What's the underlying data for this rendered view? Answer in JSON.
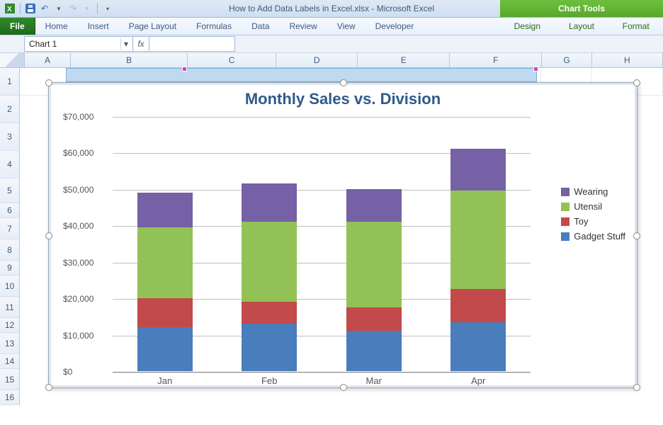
{
  "titlebar": {
    "doc_title": "How to Add Data Labels in Excel.xlsx - Microsoft Excel",
    "chart_tools_label": "Chart Tools"
  },
  "ribbon": {
    "file": "File",
    "tabs": [
      "Home",
      "Insert",
      "Page Layout",
      "Formulas",
      "Data",
      "Review",
      "View",
      "Developer"
    ],
    "ctx_tabs": [
      "Design",
      "Layout",
      "Format"
    ]
  },
  "fxbar": {
    "namebox_value": "Chart 1",
    "fx_symbol": "fx"
  },
  "columns": [
    "A",
    "B",
    "C",
    "D",
    "E",
    "F",
    "G",
    "H"
  ],
  "rows": [
    "1",
    "2",
    "3",
    "4",
    "5",
    "6",
    "7",
    "8",
    "9",
    "10",
    "11",
    "12",
    "13",
    "14",
    "15",
    "16"
  ],
  "chart_title": "Monthly Sales vs. Division",
  "legend": {
    "wearing": "Wearing",
    "utensil": "Utensil",
    "toy": "Toy",
    "gadget": "Gadget Stuff"
  },
  "y_ticks": [
    "$70,000",
    "$60,000",
    "$50,000",
    "$40,000",
    "$30,000",
    "$20,000",
    "$10,000",
    "$0"
  ],
  "x_ticks": [
    "Jan",
    "Feb",
    "Mar",
    "Apr"
  ],
  "chart_data": {
    "type": "bar",
    "stacked": true,
    "title": "Monthly Sales vs. Division",
    "xlabel": "",
    "ylabel": "",
    "ylim": [
      0,
      70000
    ],
    "y_format": "$#,##0",
    "categories": [
      "Jan",
      "Feb",
      "Mar",
      "Apr"
    ],
    "series": [
      {
        "name": "Gadget Stuff",
        "color": "#4a7dbb",
        "values": [
          12000,
          13000,
          11000,
          13500
        ]
      },
      {
        "name": "Toy",
        "color": "#c24a4a",
        "values": [
          8000,
          6000,
          6500,
          9000
        ]
      },
      {
        "name": "Utensil",
        "color": "#92c255",
        "values": [
          19500,
          22000,
          23500,
          27000
        ]
      },
      {
        "name": "Wearing",
        "color": "#7660a6",
        "values": [
          9500,
          10500,
          9000,
          11500
        ]
      }
    ],
    "legend_position": "right",
    "grid": true
  }
}
